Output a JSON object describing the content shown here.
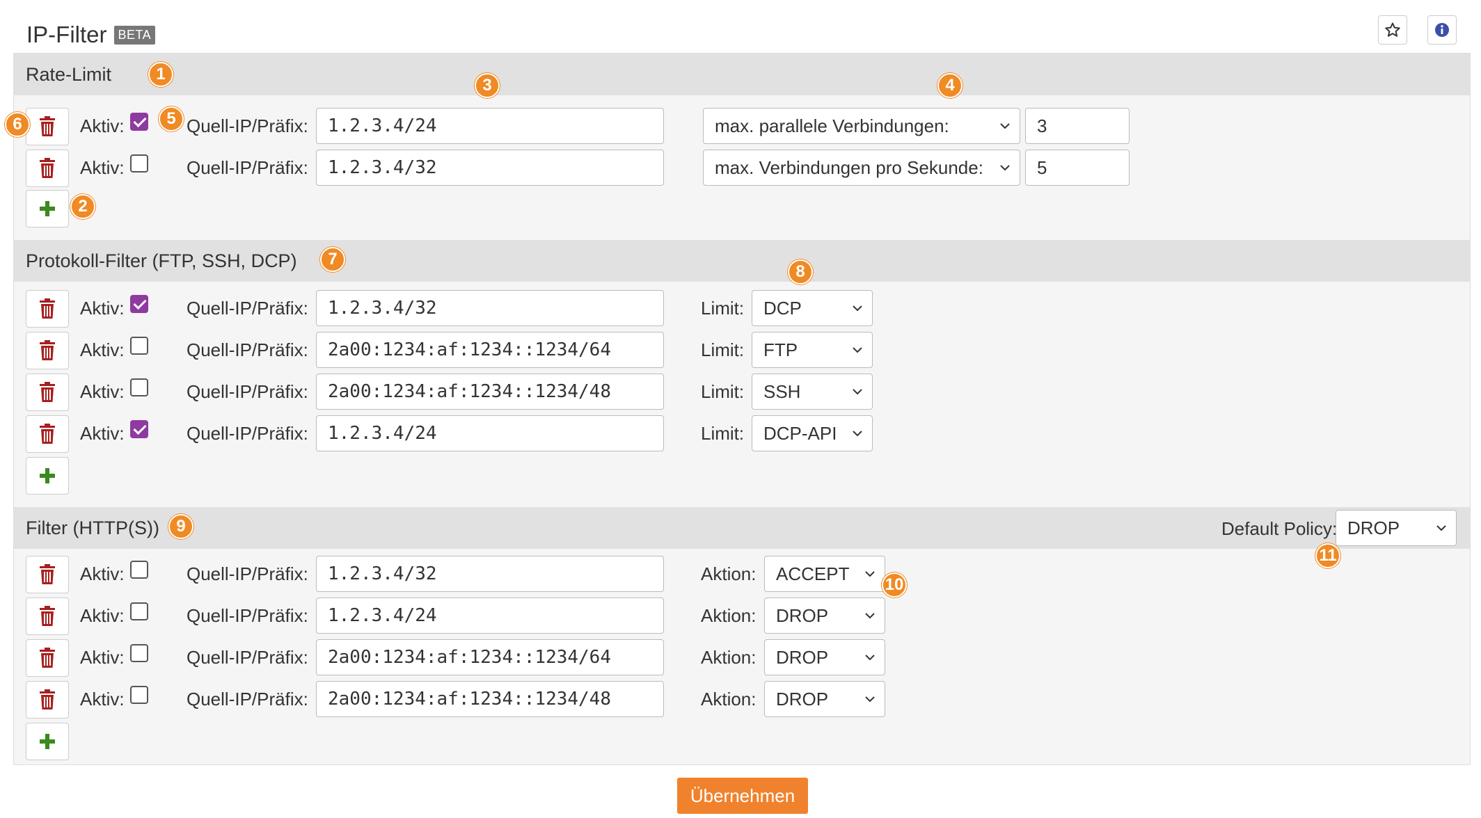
{
  "header": {
    "title": "IP-Filter",
    "badge": "BETA"
  },
  "labels": {
    "aktiv": "Aktiv:",
    "ip": "Quell-IP/Präfix:",
    "limit": "Limit:",
    "aktion": "Aktion:",
    "default_policy": "Default Policy:"
  },
  "markers": [
    "1",
    "2",
    "3",
    "4",
    "5",
    "6",
    "7",
    "8",
    "9",
    "10",
    "11"
  ],
  "rate_limit": {
    "title": "Rate-Limit",
    "rows": [
      {
        "active": true,
        "ip": "1.2.3.4/24",
        "mode": "max. parallele Verbindungen:",
        "value": "3"
      },
      {
        "active": false,
        "ip": "1.2.3.4/32",
        "mode": "max. Verbindungen pro Sekunde:",
        "value": "5"
      }
    ]
  },
  "protocol_filter": {
    "title": "Protokoll-Filter (FTP, SSH, DCP)",
    "rows": [
      {
        "active": true,
        "ip": "1.2.3.4/32",
        "limit": "DCP"
      },
      {
        "active": false,
        "ip": "2a00:1234:af:1234::1234/64",
        "limit": "FTP"
      },
      {
        "active": false,
        "ip": "2a00:1234:af:1234::1234/48",
        "limit": "SSH"
      },
      {
        "active": true,
        "ip": "1.2.3.4/24",
        "limit": "DCP-API"
      }
    ]
  },
  "http_filter": {
    "title": "Filter (HTTP(S))",
    "default_policy": "DROP",
    "rows": [
      {
        "active": false,
        "ip": "1.2.3.4/32",
        "action": "ACCEPT"
      },
      {
        "active": false,
        "ip": "1.2.3.4/24",
        "action": "DROP"
      },
      {
        "active": false,
        "ip": "2a00:1234:af:1234::1234/64",
        "action": "DROP"
      },
      {
        "active": false,
        "ip": "2a00:1234:af:1234::1234/48",
        "action": "DROP"
      }
    ]
  },
  "submit_label": "Übernehmen",
  "colors": {
    "accent": "#f0822d",
    "badge": "#f08a24",
    "check": "#8e3aa0",
    "trash": "#a6201f",
    "plus": "#3a8a1f"
  },
  "icons": {
    "star": "star-icon",
    "info": "info-icon",
    "trash": "trash-icon",
    "plus": "plus-icon",
    "chevron": "chevron-down-icon"
  }
}
